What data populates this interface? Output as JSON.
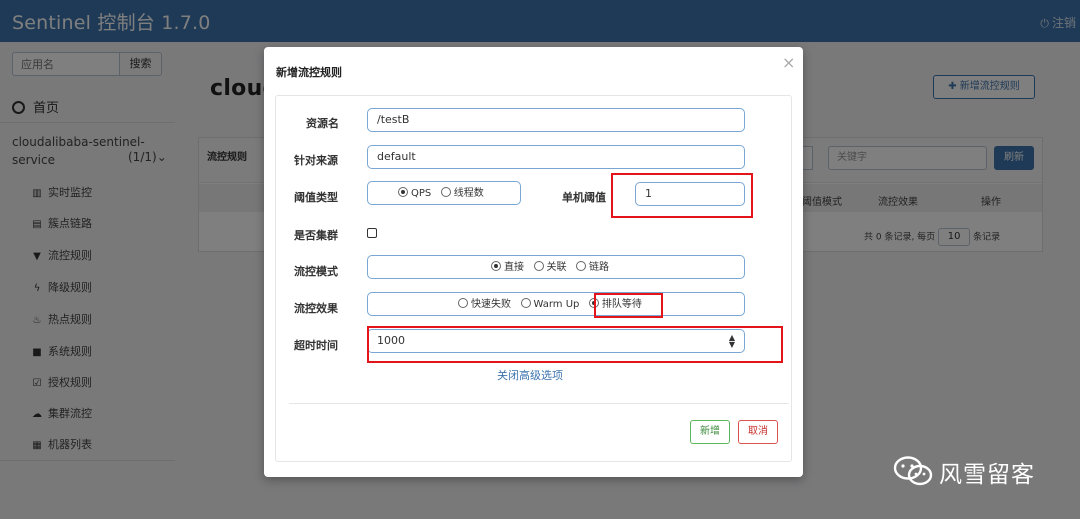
{
  "header": {
    "brand": "Sentinel 控制台 1.7.0",
    "logout_label": "注销"
  },
  "sidebar": {
    "search_placeholder": "应用名",
    "search_button": "搜索",
    "home_label": "首页",
    "app_name": "cloudalibaba-sentinel-service",
    "app_count": "(1/1)",
    "items": [
      {
        "label": "实时监控",
        "icon": "bar-chart-icon"
      },
      {
        "label": "簇点链路",
        "icon": "list-icon"
      },
      {
        "label": "流控规则",
        "icon": "filter-icon"
      },
      {
        "label": "降级规则",
        "icon": "flash-icon"
      },
      {
        "label": "热点规则",
        "icon": "fire-icon"
      },
      {
        "label": "系统规则",
        "icon": "lock-icon"
      },
      {
        "label": "授权规则",
        "icon": "check-icon"
      },
      {
        "label": "集群流控",
        "icon": "cloud-icon"
      },
      {
        "label": "机器列表",
        "icon": "grid-icon"
      }
    ]
  },
  "main": {
    "page_title": "cloud",
    "add_rule_button": "新增流控规则",
    "panel_title": "流控规则",
    "keyword_placeholder": "关键字",
    "refresh_button": "刷新",
    "columns": [
      "阈值模式",
      "流控效果",
      "操作"
    ],
    "pager": {
      "text_before": "共 0 条记录, 每页",
      "page_size": "10",
      "text_after": "条记录"
    }
  },
  "modal": {
    "title": "新增流控规则",
    "close_symbol": "×",
    "fields": {
      "resource": {
        "label": "资源名",
        "value": "/testB"
      },
      "source": {
        "label": "针对来源",
        "value": "default"
      },
      "threshold_type": {
        "label": "阈值类型",
        "options": [
          "QPS",
          "线程数"
        ],
        "selected": "QPS"
      },
      "threshold": {
        "label": "单机阈值",
        "value": "1"
      },
      "cluster": {
        "label": "是否集群",
        "checked": false
      },
      "mode": {
        "label": "流控模式",
        "options": [
          "直接",
          "关联",
          "链路"
        ],
        "selected": "直接"
      },
      "effect": {
        "label": "流控效果",
        "options": [
          "快速失败",
          "Warm Up",
          "排队等待"
        ],
        "selected": "排队等待"
      },
      "timeout": {
        "label": "超时时间",
        "value": "1000"
      }
    },
    "advanced_link": "关闭高级选项",
    "add_button": "新增",
    "cancel_button": "取消"
  },
  "watermark": {
    "text": "风雪留客"
  },
  "colors": {
    "header": "#3c74ad",
    "highlight": "#e4141b",
    "add_button": "#5cb85c",
    "cancel_button": "#d9534f"
  }
}
